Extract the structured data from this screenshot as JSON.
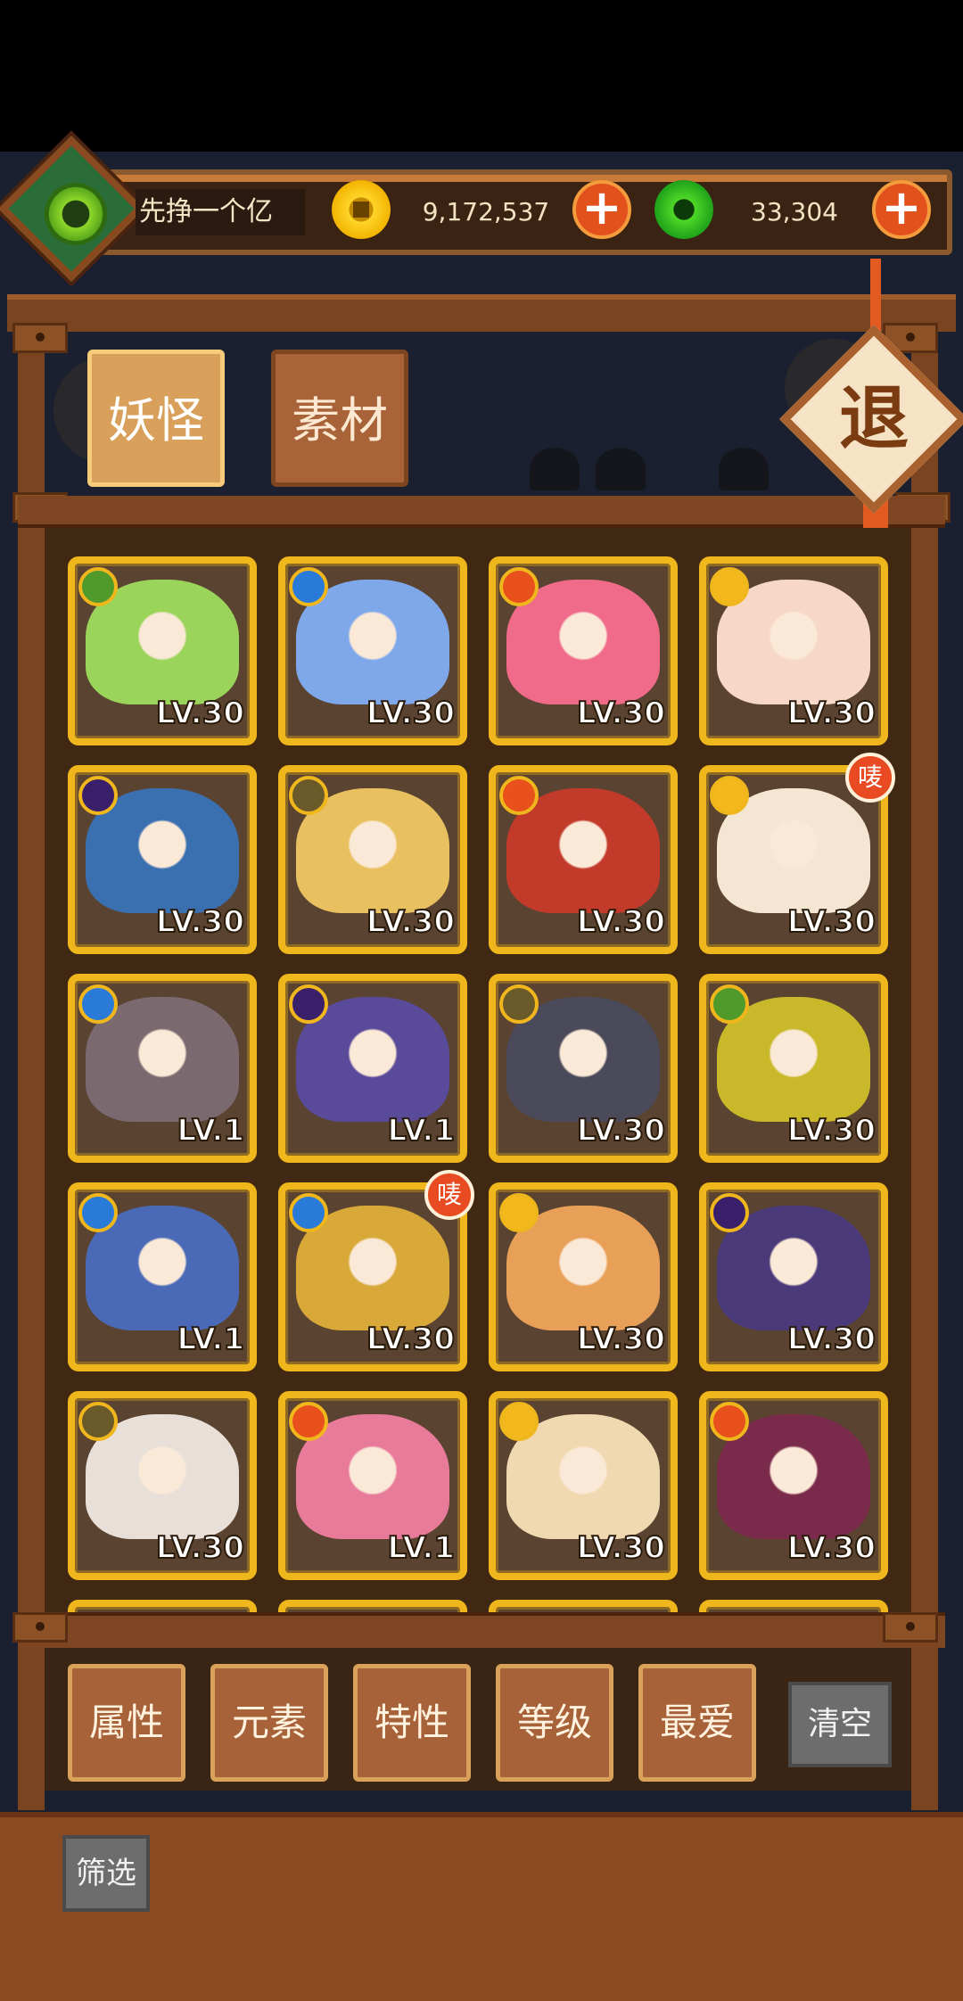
{
  "player": {
    "name": "先挣一个亿"
  },
  "currency": {
    "gold": "9,172,537",
    "jade": "33,304",
    "plus_symbol": "+"
  },
  "tabs": [
    {
      "label": "妖怪",
      "active": true
    },
    {
      "label": "素材",
      "active": false
    }
  ],
  "exit_label": "退",
  "badge_text": "唛",
  "cards": [
    {
      "element": "wood",
      "level": "LV.30",
      "color": "#9bd45a",
      "badge": false
    },
    {
      "element": "water",
      "level": "LV.30",
      "color": "#7ea8ea",
      "badge": false
    },
    {
      "element": "fire",
      "level": "LV.30",
      "color": "#f06a8a",
      "badge": false
    },
    {
      "element": "light",
      "level": "LV.30",
      "color": "#f7d8c8",
      "badge": false
    },
    {
      "element": "dark",
      "level": "LV.30",
      "color": "#3a6fb0",
      "badge": false
    },
    {
      "element": "earth",
      "level": "LV.30",
      "color": "#e8c060",
      "badge": false
    },
    {
      "element": "fire",
      "level": "LV.30",
      "color": "#c23a2a",
      "badge": false
    },
    {
      "element": "light",
      "level": "LV.30",
      "color": "#f4e6d2",
      "badge": true
    },
    {
      "element": "water",
      "level": "LV.1",
      "color": "#7a6a70",
      "badge": false
    },
    {
      "element": "dark",
      "level": "LV.1",
      "color": "#5a4a9a",
      "badge": false
    },
    {
      "element": "earth",
      "level": "LV.30",
      "color": "#4a4a5a",
      "badge": false
    },
    {
      "element": "wood",
      "level": "LV.30",
      "color": "#c8b82a",
      "badge": false
    },
    {
      "element": "water",
      "level": "LV.1",
      "color": "#4a6ab8",
      "badge": false
    },
    {
      "element": "water",
      "level": "LV.30",
      "color": "#d8a838",
      "badge": true
    },
    {
      "element": "light",
      "level": "LV.30",
      "color": "#e8a058",
      "badge": false
    },
    {
      "element": "dark",
      "level": "LV.30",
      "color": "#4a3a7a",
      "badge": false
    },
    {
      "element": "earth",
      "level": "LV.30",
      "color": "#e8e0d8",
      "badge": false
    },
    {
      "element": "fire",
      "level": "LV.1",
      "color": "#e87a9a",
      "badge": false
    },
    {
      "element": "light",
      "level": "LV.30",
      "color": "#f0d8b0",
      "badge": false
    },
    {
      "element": "fire",
      "level": "LV.30",
      "color": "#7a2a4a",
      "badge": false
    }
  ],
  "element_colors": {
    "wood": "#4f9a2a",
    "water": "#2a7ad8",
    "fire": "#e8501c",
    "light": "#f4b81c",
    "dark": "#3a1f6a",
    "earth": "#6a5a2a"
  },
  "filters": [
    "属性",
    "元素",
    "特性",
    "等级",
    "最爱"
  ],
  "clear_label": "清空",
  "screen_label": "筛选"
}
